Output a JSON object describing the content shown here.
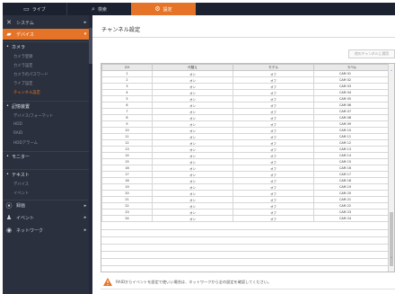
{
  "topbar": {
    "tabs": [
      {
        "label": "ライブ",
        "icon": "monitor-icon"
      },
      {
        "label": "検索",
        "icon": "search-icon"
      },
      {
        "label": "設定",
        "icon": "gear-icon"
      }
    ]
  },
  "sidebar": {
    "system": "システム",
    "device": "デバイス",
    "camera_section": "カメラ",
    "camera_items": [
      "カメラ登録",
      "カメラ設定",
      "カメラのパスワード",
      "ライブ設定",
      "チャンネル設定"
    ],
    "storage_section": "記憶装置",
    "storage_items": [
      "デバイス/フォーマット",
      "HDD",
      "RAID",
      "HDDアラーム"
    ],
    "monitor": "モニター",
    "textlink": "テキスト",
    "textlink_items": [
      "デバイス",
      "イベント"
    ],
    "record": "録画",
    "event": "イベント",
    "network": "ネットワーク"
  },
  "main": {
    "title": "チャンネル設定",
    "apply_label": "他のチャンネルに適用",
    "columns": [
      "CH",
      "代替え",
      "モデル",
      "ラベル"
    ],
    "rows": [
      [
        "1",
        "オン",
        "オフ",
        "CAM 01"
      ],
      [
        "2",
        "オン",
        "オフ",
        "CAM 02"
      ],
      [
        "3",
        "オン",
        "オフ",
        "CAM 03"
      ],
      [
        "4",
        "オン",
        "オフ",
        "CAM 04"
      ],
      [
        "5",
        "オン",
        "オフ",
        "CAM 05"
      ],
      [
        "6",
        "オン",
        "オフ",
        "CAM 06"
      ],
      [
        "7",
        "オン",
        "オフ",
        "CAM 07"
      ],
      [
        "8",
        "オン",
        "オフ",
        "CAM 08"
      ],
      [
        "9",
        "オン",
        "オフ",
        "CAM 09"
      ],
      [
        "10",
        "オン",
        "オフ",
        "CAM 10"
      ],
      [
        "11",
        "オン",
        "オフ",
        "CAM 11"
      ],
      [
        "12",
        "オン",
        "オフ",
        "CAM 12"
      ],
      [
        "13",
        "オン",
        "オフ",
        "CAM 13"
      ],
      [
        "14",
        "オン",
        "オフ",
        "CAM 14"
      ],
      [
        "15",
        "オン",
        "オフ",
        "CAM 15"
      ],
      [
        "16",
        "オン",
        "オフ",
        "CAM 16"
      ],
      [
        "17",
        "オン",
        "オフ",
        "CAM 17"
      ],
      [
        "18",
        "オン",
        "オフ",
        "CAM 18"
      ],
      [
        "19",
        "オン",
        "オフ",
        "CAM 19"
      ],
      [
        "20",
        "オン",
        "オフ",
        "CAM 20"
      ],
      [
        "21",
        "オン",
        "オフ",
        "CAM 21"
      ],
      [
        "22",
        "オン",
        "オフ",
        "CAM 22"
      ],
      [
        "23",
        "オン",
        "オフ",
        "CAM 23"
      ],
      [
        "24",
        "オン",
        "オフ",
        "CAM 24"
      ]
    ],
    "note": "RAIDからイベントを設定で使いい場合は、ネットワークから全の設定を確認してください。"
  },
  "colors": {
    "accent": "#e57428",
    "sidebar_bg": "#2a303d",
    "topbar_bg": "#1d2230"
  }
}
